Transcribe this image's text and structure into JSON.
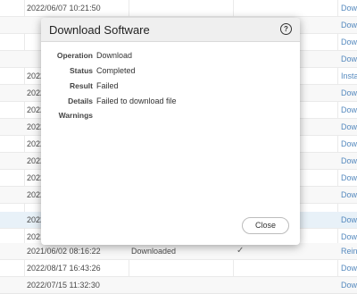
{
  "background_table": {
    "rows": [
      {
        "date": "2022/06/07 10:21:50",
        "status": "",
        "check": "",
        "action": "Dow"
      },
      {
        "date": "",
        "status": "",
        "check": "",
        "action": "Dow"
      },
      {
        "date": "",
        "status": "",
        "check": "",
        "action": "Dow"
      },
      {
        "date": "",
        "status": "",
        "check": "",
        "action": "Dow"
      },
      {
        "date": "",
        "status": "",
        "check": "",
        "action": "Insta"
      },
      {
        "date": "",
        "status": "",
        "check": "",
        "action": "Dow"
      },
      {
        "date": "",
        "status": "",
        "check": "",
        "action": "Dow"
      },
      {
        "date": "",
        "status": "",
        "check": "",
        "action": "Dow"
      },
      {
        "date": "",
        "status": "",
        "check": "",
        "action": "Dow"
      },
      {
        "date": "",
        "status": "",
        "check": "",
        "action": "Dow"
      },
      {
        "date": "",
        "status": "",
        "check": "",
        "action": "Dow"
      },
      {
        "date": "",
        "status": "",
        "check": "",
        "action": "Dow"
      },
      {
        "date": "",
        "status": "",
        "check": "",
        "action": "Dow"
      },
      {
        "date": "",
        "status": "",
        "check": "",
        "action": "Dow"
      },
      {
        "date": "2021/06/02 08:16:22",
        "status": "Downloaded",
        "check": "✓",
        "action": "Reins"
      },
      {
        "date": "2022/08/17 16:43:26",
        "status": "",
        "check": "",
        "action": "Dow"
      },
      {
        "date": "2022/07/15 11:32:30",
        "status": "",
        "check": "",
        "action": "Dow"
      }
    ],
    "partial_date_prefix": "2022",
    "partial_date_prefix_2021": "2021"
  },
  "dialog": {
    "title": "Download Software",
    "fields": [
      {
        "label": "Operation",
        "value": "Download"
      },
      {
        "label": "Status",
        "value": "Completed"
      },
      {
        "label": "Result",
        "value": "Failed"
      },
      {
        "label": "Details",
        "value": "Failed to download file"
      },
      {
        "label": "Warnings",
        "value": ""
      }
    ],
    "close_label": "Close",
    "help_icon": "?"
  }
}
